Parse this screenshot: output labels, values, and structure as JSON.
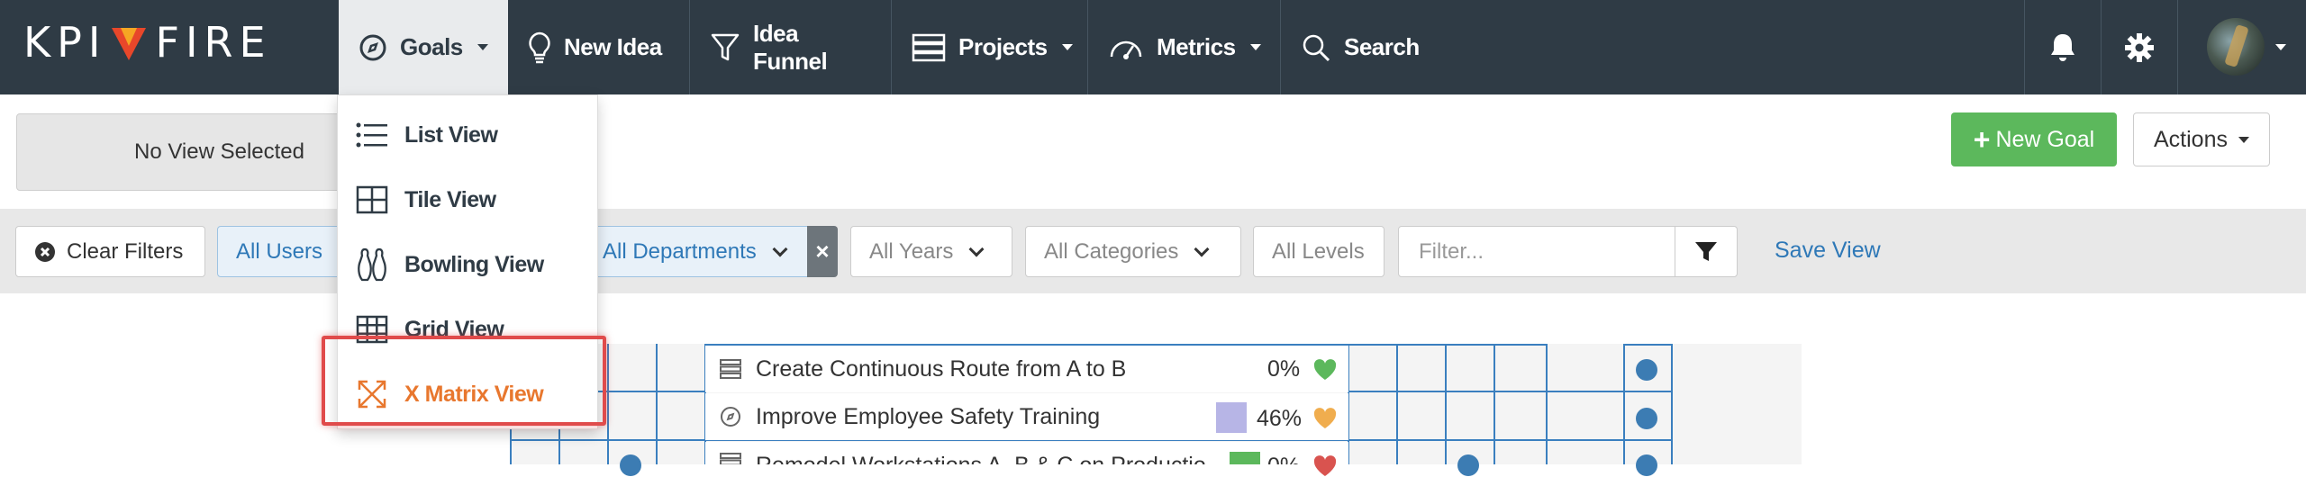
{
  "brand": {
    "left": "KPI",
    "right": "FIRE",
    "accent": "#e8472a"
  },
  "nav": {
    "goals": "Goals",
    "new_idea": "New Idea",
    "idea_funnel": "Idea Funnel",
    "projects": "Projects",
    "metrics": "Metrics",
    "search": "Search"
  },
  "toolbar": {
    "view_selected": "No View Selected",
    "new_goal": "New Goal",
    "actions": "Actions"
  },
  "filters": {
    "clear": "Clear Filters",
    "users": "All Users",
    "departments": "All Departments",
    "years": "All Years",
    "categories": "All Categories",
    "levels": "All Levels",
    "placeholder": "Filter...",
    "save_view": "Save View"
  },
  "goals_menu": {
    "items": [
      {
        "label": "List View",
        "icon": "list-icon"
      },
      {
        "label": "Tile View",
        "icon": "tile-icon"
      },
      {
        "label": "Bowling View",
        "icon": "bowling-icon"
      },
      {
        "label": "Grid View",
        "icon": "grid-icon"
      },
      {
        "label": "X Matrix View",
        "icon": "expand-arrows-icon",
        "highlighted": true
      }
    ]
  },
  "goal_rows": [
    {
      "title": "Create Continuous Route from A to B",
      "icon": "server-icon",
      "percent": "0%",
      "status": "green"
    },
    {
      "title": "Improve Employee Safety Training",
      "icon": "compass-icon",
      "percent": "46%",
      "status": "orange"
    },
    {
      "title": "Remodel Workstations A, B & C on Production",
      "icon": "server-icon",
      "percent": "0%",
      "status": "red"
    }
  ],
  "colors": {
    "navbar": "#2f3b45",
    "accent_orange": "#e8772e",
    "success": "#5cb85c",
    "link": "#2e78b7",
    "status_green": "#5cb85c",
    "status_orange": "#f0ad4e",
    "status_red": "#d9534f"
  }
}
